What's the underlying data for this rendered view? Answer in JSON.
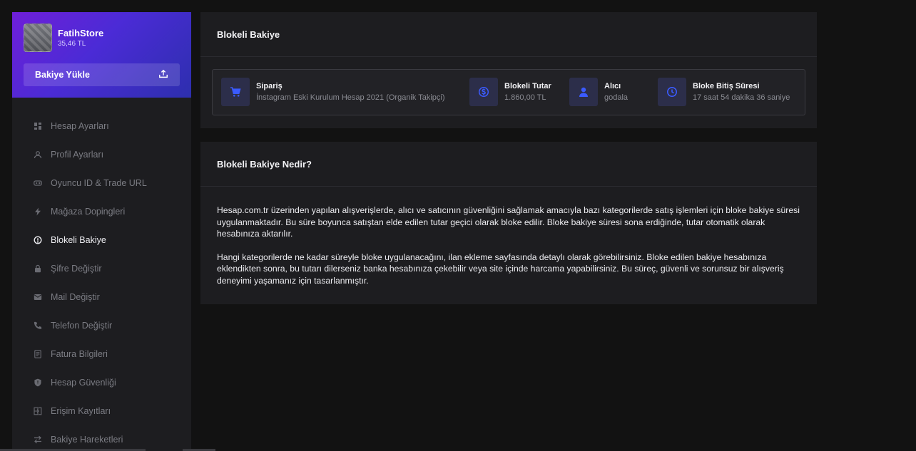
{
  "profile": {
    "name": "FatihStore",
    "balance": "35,46 TL",
    "topup_label": "Bakiye Yükle"
  },
  "menu": [
    {
      "label": "Hesap Ayarları",
      "icon": "dashboard-icon",
      "active": false
    },
    {
      "label": "Profil Ayarları",
      "icon": "user-icon",
      "active": false
    },
    {
      "label": "Oyuncu ID & Trade URL",
      "icon": "gamepad-icon",
      "active": false
    },
    {
      "label": "Mağaza Dopingleri",
      "icon": "bolt-icon",
      "active": false
    },
    {
      "label": "Blokeli Bakiye",
      "icon": "alert-circle-icon",
      "active": true
    },
    {
      "label": "Şifre Değiştir",
      "icon": "lock-icon",
      "active": false
    },
    {
      "label": "Mail Değiştir",
      "icon": "mail-icon",
      "active": false
    },
    {
      "label": "Telefon Değiştir",
      "icon": "phone-icon",
      "active": false
    },
    {
      "label": "Fatura Bilgileri",
      "icon": "document-icon",
      "active": false
    },
    {
      "label": "Hesap Güvenliği",
      "icon": "shield-icon",
      "active": false
    },
    {
      "label": "Erişim Kayıtları",
      "icon": "login-icon",
      "active": false
    },
    {
      "label": "Bakiye Hareketleri",
      "icon": "swap-icon",
      "active": false
    }
  ],
  "blocked": {
    "title": "Blokeli Bakiye",
    "order": {
      "label": "Sipariş",
      "value": "İnstagram Eski Kurulum Hesap 2021 (Organik Takipçi)",
      "icon": "cart-icon"
    },
    "amount": {
      "label": "Blokeli Tutar",
      "value": "1.860,00 TL",
      "icon": "dollar-circle-icon"
    },
    "buyer": {
      "label": "Alıcı",
      "value": "godala",
      "icon": "person-icon"
    },
    "expiry": {
      "label": "Bloke Bitiş Süresi",
      "value": "17 saat 54 dakika 36 saniye",
      "icon": "clock-icon"
    }
  },
  "info": {
    "title": "Blokeli Bakiye Nedir?",
    "paragraph1": "Hesap.com.tr üzerinden yapılan alışverişlerde, alıcı ve satıcının güvenliğini sağlamak amacıyla bazı kategorilerde satış işlemleri için bloke bakiye süresi uygulanmaktadır. Bu süre boyunca satıştan elde edilen tutar geçici olarak bloke edilir. Bloke bakiye süresi sona erdiğinde, tutar otomatik olarak hesabınıza aktarılır.",
    "paragraph2": "Hangi kategorilerde ne kadar süreyle bloke uygulanacağını, ilan ekleme sayfasında detaylı olarak görebilirsiniz. Bloke edilen bakiye hesabınıza eklendikten sonra, bu tutarı dilerseniz banka hesabınıza çekebilir veya site içinde harcama yapabilirsiniz. Bu süreç, güvenli ve sorunsuz bir alışveriş deneyimi yaşamanız için tasarlanmıştır."
  },
  "colors": {
    "accent": "#3b5bff",
    "icon_bg": "#2c2e4a",
    "profile_gradient_start": "#6f1fd8",
    "profile_gradient_end": "#2d2fae"
  }
}
